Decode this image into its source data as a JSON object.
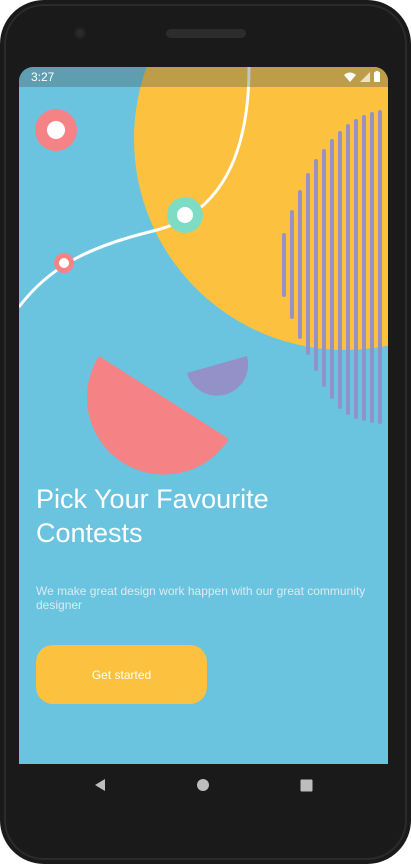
{
  "status_bar": {
    "time": "3:27",
    "icons": [
      "wifi-icon",
      "signal-icon",
      "battery-icon"
    ]
  },
  "onboarding": {
    "title_line1": "Pick Your Favourite",
    "title_line2": "Contests",
    "subtitle": "We make great design work happen with our great community designer",
    "cta_label": "Get started"
  },
  "navigation_bar": {
    "buttons": [
      "back-icon",
      "home-icon",
      "recents-icon"
    ]
  },
  "colors": {
    "background": "#6ac4df",
    "accent_yellow": "#fcc23f",
    "accent_coral": "#f58385",
    "accent_purple": "#9490c8",
    "accent_mint": "#7fdcc4",
    "text_primary": "#ffffff"
  }
}
